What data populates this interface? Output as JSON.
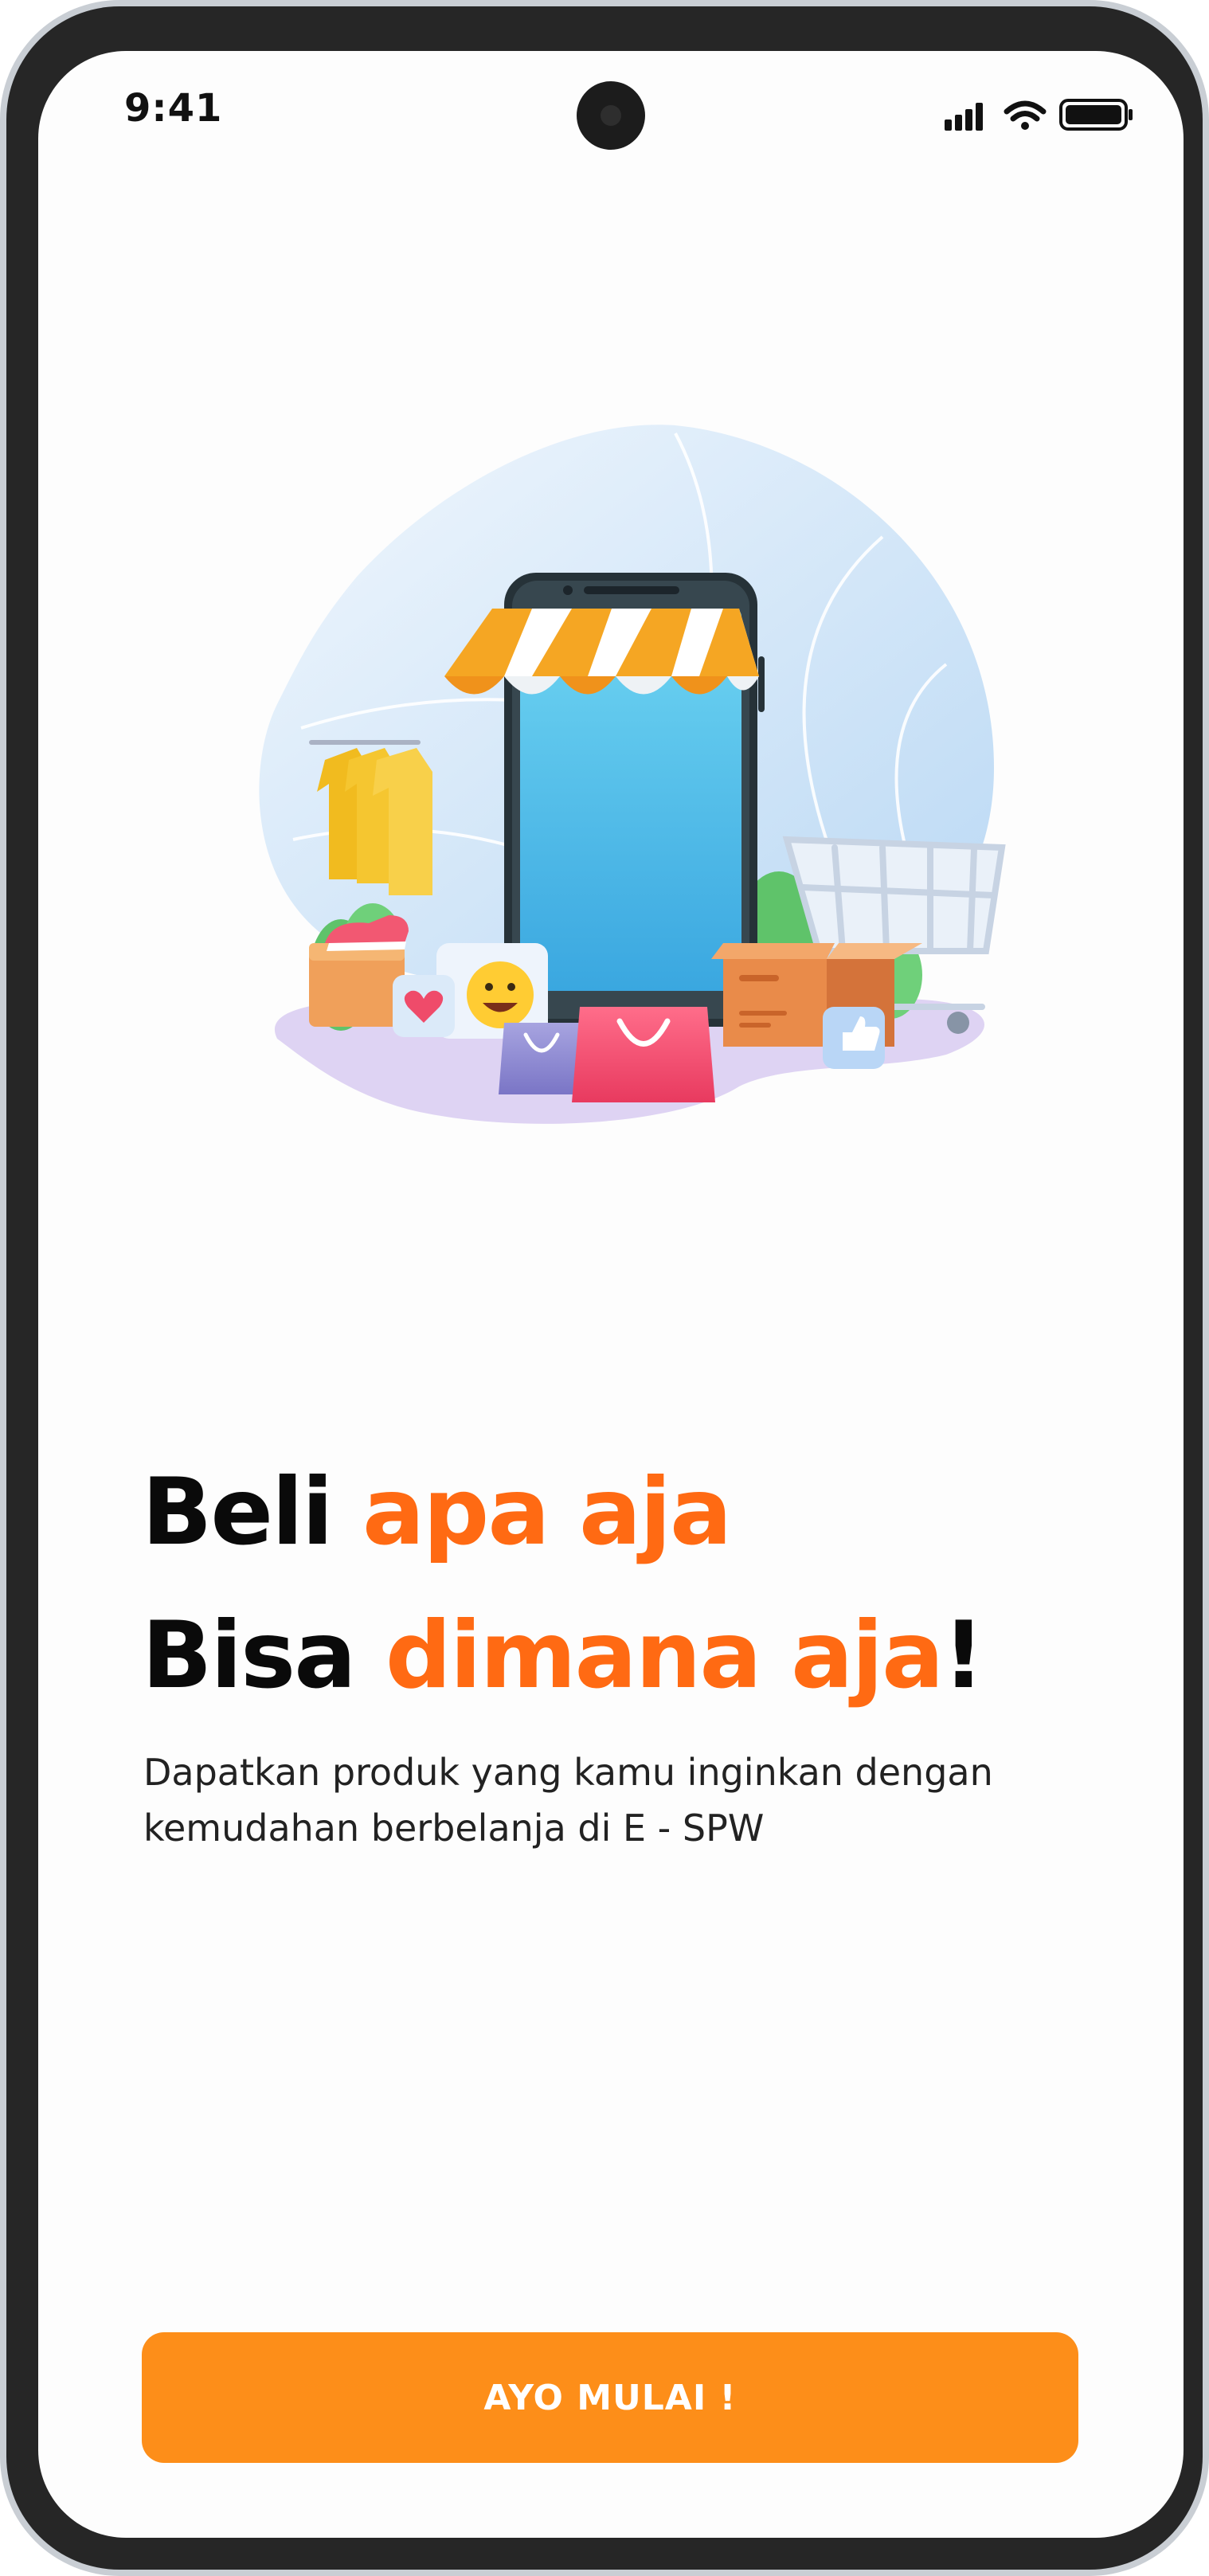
{
  "status_bar": {
    "time": "9:41",
    "icons": [
      "signal-icon",
      "wifi-icon",
      "battery-icon"
    ]
  },
  "hero": {
    "illustration": "online-shop-illustration"
  },
  "headline": {
    "line1_plain": "Beli ",
    "line1_accent": "apa aja",
    "line2_plain": "Bisa ",
    "line2_accent": "dimana aja",
    "line2_end": "!"
  },
  "subtitle": "Dapatkan produk yang kamu inginkan dengan kemudahan berbelanja di E - SPW",
  "cta": {
    "label": "AYO MULAI !"
  },
  "colors": {
    "accent": "#ff6a13",
    "button": "#fd8e19",
    "text": "#0a0a0a"
  }
}
